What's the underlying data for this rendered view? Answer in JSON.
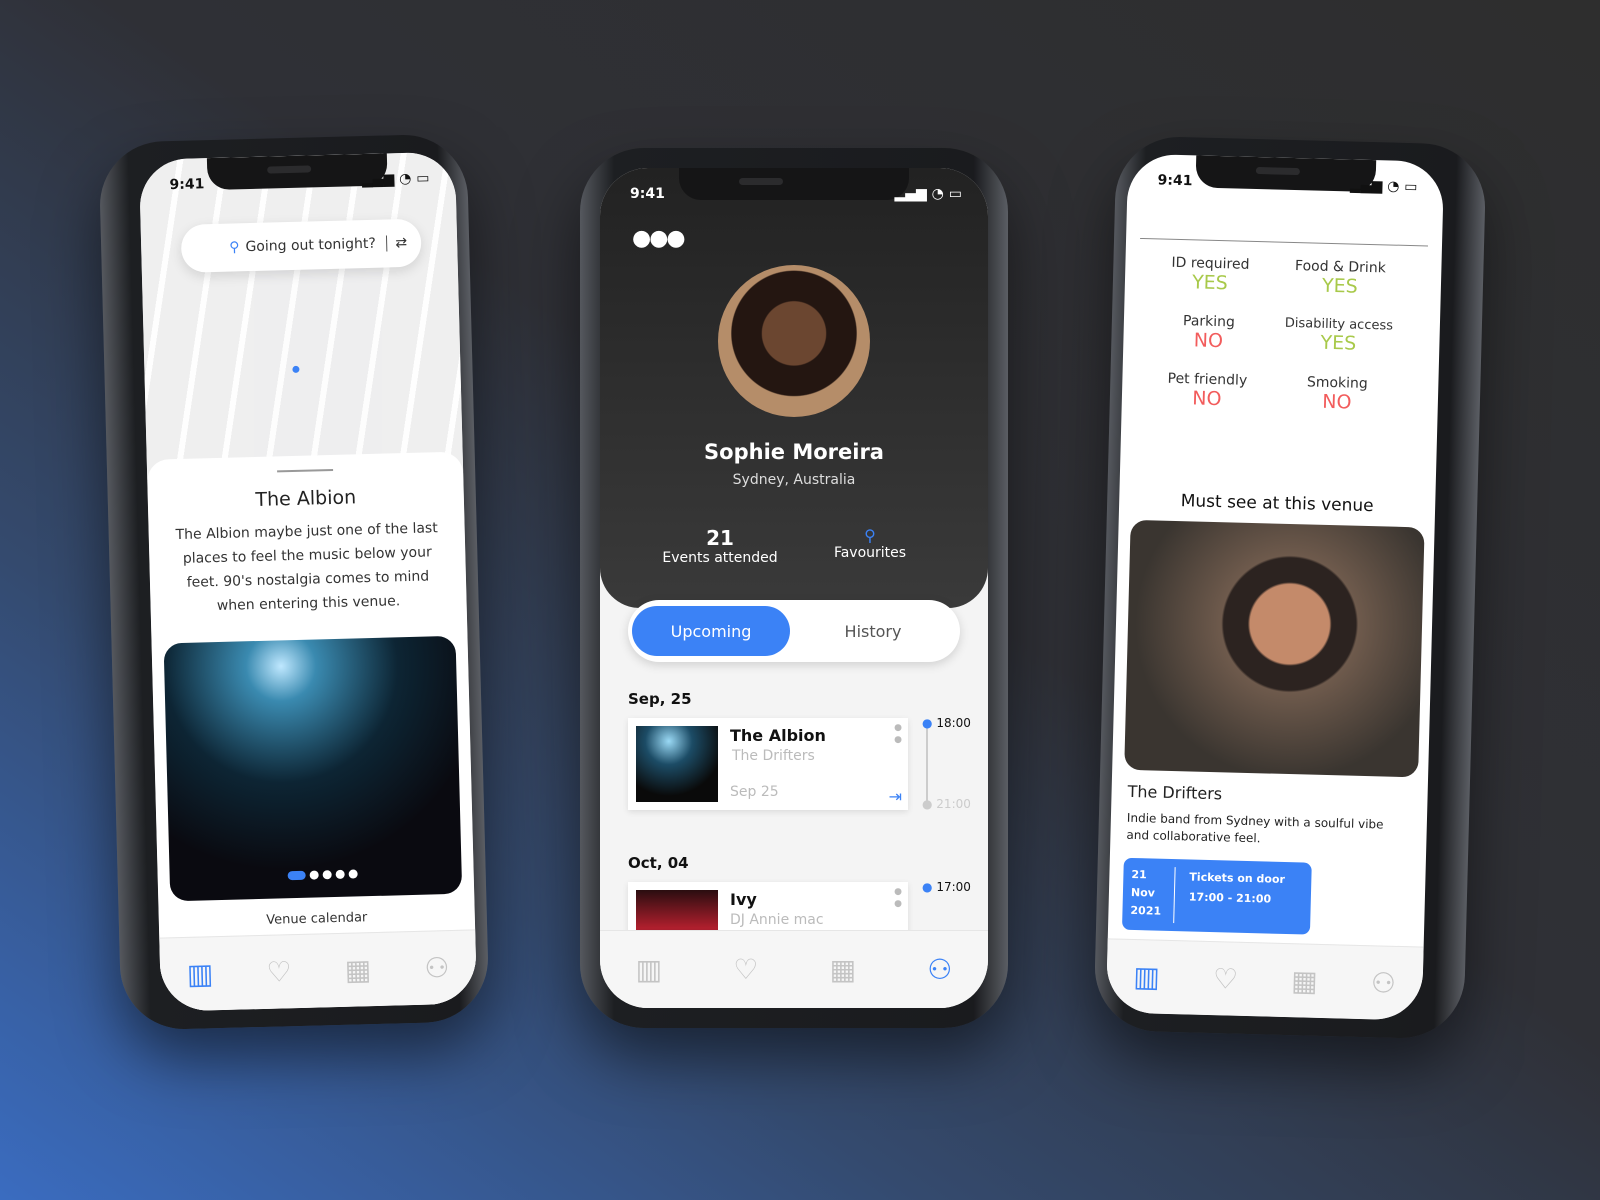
{
  "status_time": "9:41",
  "phone1": {
    "search_placeholder": "Going out tonight?",
    "venue_title": "The Albion",
    "venue_description": "The Albion maybe just one of the last places to feel the music below your feet. 90's nostalgia comes to mind when entering this venue.",
    "carousel_pages": 5,
    "carousel_active": 1,
    "venue_calendar_label": "Venue calendar"
  },
  "phone2": {
    "name": "Sophie Moreira",
    "location": "Sydney, Australia",
    "events_attended_count": "21",
    "events_attended_label": "Events attended",
    "favourites_label": "Favourites",
    "tabs": [
      {
        "label": "Upcoming",
        "active": true
      },
      {
        "label": "History",
        "active": false
      }
    ],
    "events": [
      {
        "date_header": "Sep, 25",
        "venue": "The Albion",
        "artist": "The Drifters",
        "date": "Sep 25",
        "start": "18:00",
        "end": "21:00"
      },
      {
        "date_header": "Oct, 04",
        "venue": "Ivy",
        "artist": "DJ Annie mac",
        "start": "17:00"
      }
    ]
  },
  "phone3": {
    "amenities": [
      {
        "label": "ID required",
        "value": "YES"
      },
      {
        "label": "Food & Drink",
        "value": "YES"
      },
      {
        "label": "Parking",
        "value": "NO"
      },
      {
        "label": "Disability access",
        "value": "YES"
      },
      {
        "label": "Pet friendly",
        "value": "NO"
      },
      {
        "label": "Smoking",
        "value": "NO"
      }
    ],
    "must_see_title": "Must see at this venue",
    "artist_name": "The Drifters",
    "artist_description": "Indie band from Sydney with a soulful vibe and collaborative feel.",
    "ticket": {
      "day": "21",
      "month": "Nov",
      "year": "2021",
      "title": "Tickets on door",
      "time": "17:00 - 21:00"
    }
  },
  "tabbar": [
    "map-icon",
    "heart-icon",
    "calendar-icon",
    "profile-icon"
  ],
  "colors": {
    "accent": "#3b82f6",
    "yes": "#a8c94a",
    "no": "#f25c5c"
  }
}
